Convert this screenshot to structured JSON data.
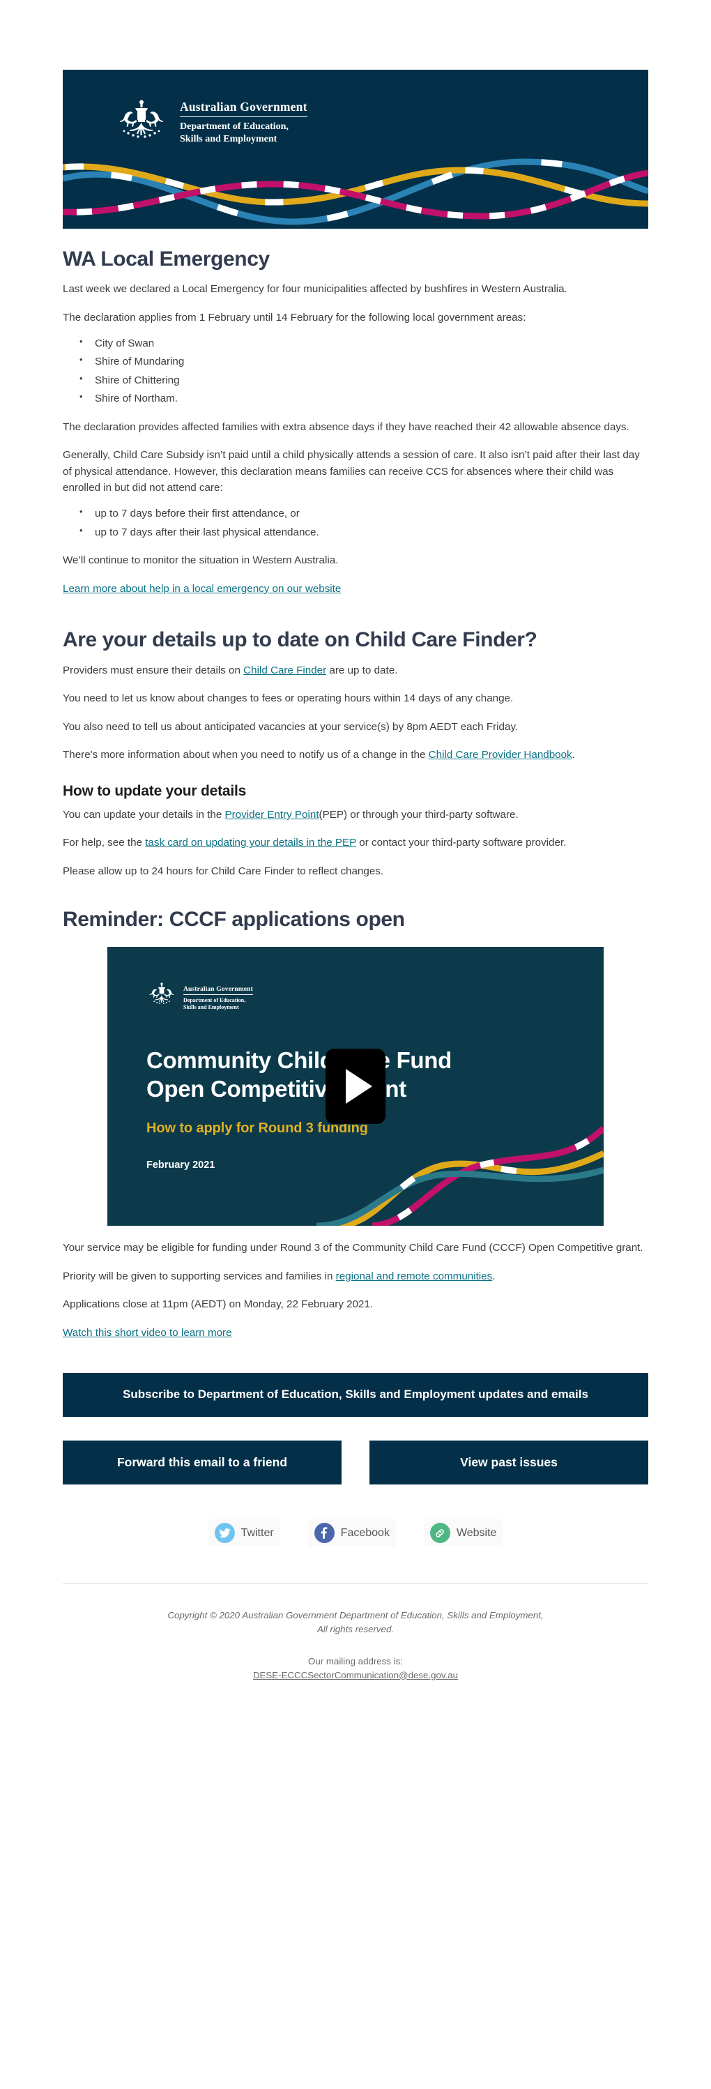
{
  "brand": {
    "dark_navy": "#033048",
    "teal_link": "#0b7285",
    "heading_color": "#333c4e",
    "wave_blue": "#2b83b5",
    "wave_gold": "#e0a91a",
    "wave_magenta": "#c2116a",
    "wave_white": "#ffffff"
  },
  "header": {
    "crest_icon": "australian-coat-of-arms-icon",
    "government_line": "Australian Government",
    "department_line_1": "Department of Education,",
    "department_line_2": "Skills and Employment"
  },
  "sections": [
    {
      "id": "wa-local-emergency",
      "heading": "WA Local Emergency",
      "paragraph_1": "Last week we declared a Local Emergency for four municipalities affected by bushfires in Western Australia.",
      "paragraph_2": "The declaration applies from 1 February until 14 February for the following local government areas:",
      "lga_list": [
        "City of Swan",
        "Shire of Mundaring",
        "Shire of Chittering",
        "Shire of Northam."
      ],
      "paragraph_3": "The declaration provides affected families with extra absence days if they have reached their 42 allowable absence days.",
      "paragraph_4": "Generally, Child Care Subsidy isn’t paid until a child physically attends a session of care. It also isn’t paid after their last day of physical attendance. However, this declaration means families can receive CCS for absences where their child was enrolled in but did not attend care:",
      "absence_list": [
        "up to 7 days before their first attendance, or",
        "up to 7 days after their last physical attendance."
      ],
      "paragraph_5": "We’ll continue to monitor the situation in Western Australia.",
      "link": "Learn more about help in a local emergency on our website"
    },
    {
      "id": "child-care-finder",
      "heading": "Are your details up to date on Child Care Finder?",
      "p1_before": "Providers must ensure their details on ",
      "p1_link": "Child Care Finder",
      "p1_after": " are up to date.",
      "paragraph_2": "You need to let us know about changes to fees or operating hours within 14 days of any change.",
      "paragraph_3": "You also need to tell us about anticipated vacancies at your service(s) by 8pm AEDT each Friday.",
      "p4_before": "There's more information about when you need to notify us of a change in the ",
      "p4_link": "Child Care Provider Handbook",
      "p4_after": ".",
      "subheading": "How to update your details",
      "p5_before": "You can update your details in the ",
      "p5_link": "Provider Entry Point",
      "p5_after": "(PEP) or through your third-party software.",
      "p6_before": "For help, see the ",
      "p6_link": "task card on updating your details in the PEP",
      "p6_after": " or contact your third-party software provider.",
      "paragraph_7": "Please allow up to 24 hours for Child Care Finder to reflect changes."
    },
    {
      "id": "cccf-applications",
      "heading": "Reminder: CCCF applications open",
      "video": {
        "play_icon": "play-button-icon",
        "crest_icon": "australian-coat-of-arms-icon",
        "government_line": "Australian Government",
        "department_line_1": "Department of Education,",
        "department_line_2": "Skills and Employment",
        "title_line_1": "Community Child Care Fund",
        "title_line_2": "Open Competitive Grant",
        "subtitle": "How to apply for Round 3 funding",
        "date": "February 2021"
      },
      "paragraph_1": "Your service may be eligible for funding under Round 3 of the Community Child Care Fund (CCCF) Open Competitive grant.",
      "p2_before": "Priority will be given to supporting services and families in ",
      "p2_link": "regional and remote communities",
      "p2_after": ".",
      "paragraph_3": "Applications close at 11pm (AEDT) on Monday, 22 February 2021.",
      "link": "Watch this short video to learn more"
    }
  ],
  "footer": {
    "subscribe_label": "Subscribe to Department of Education, Skills and Employment updates and emails",
    "forward_label": "Forward this email to a friend",
    "past_issues_label": "View past issues",
    "social": [
      {
        "icon": "twitter-icon",
        "label": "Twitter",
        "color": "#6fc5ef"
      },
      {
        "icon": "facebook-icon",
        "label": "Facebook",
        "color": "#4a67ad"
      },
      {
        "icon": "link-icon",
        "label": "Website",
        "color": "#4fb783"
      }
    ],
    "copyright_line_1": "Copyright © 2020 Australian Government Department of Education, Skills and Employment,",
    "copyright_line_2": "All rights reserved.",
    "mailing_label": "Our mailing address is:",
    "mailing_address": "DESE-ECCCSectorCommunication@dese.gov.au"
  }
}
